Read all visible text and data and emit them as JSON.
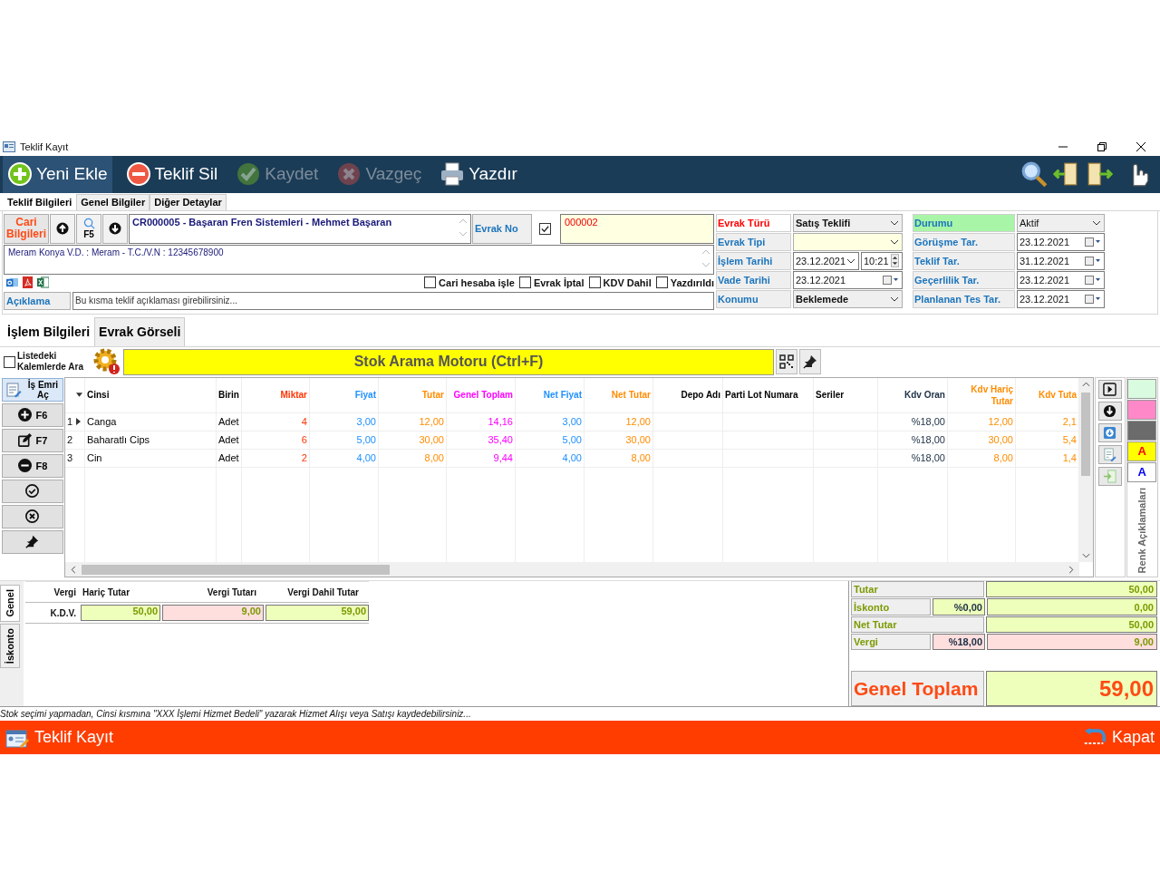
{
  "window": {
    "title": "Teklif Kayıt"
  },
  "toolbar": [
    {
      "label": "Yeni Ekle",
      "kind": "add",
      "disabled": false,
      "selected": true
    },
    {
      "label": "Teklif Sil",
      "kind": "delete",
      "disabled": false,
      "selected": false
    },
    {
      "label": "Kaydet",
      "kind": "save",
      "disabled": true,
      "selected": false
    },
    {
      "label": "Vazgeç",
      "kind": "cancel",
      "disabled": true,
      "selected": false
    },
    {
      "label": "Yazdır",
      "kind": "print",
      "disabled": false,
      "selected": false
    }
  ],
  "form_tabs": [
    {
      "label": "Teklif Bilgileri",
      "selected": true
    },
    {
      "label": "Genel Bilgiler",
      "selected": false
    },
    {
      "label": "Diğer Detaylar",
      "selected": false
    }
  ],
  "cari": {
    "button": "Cari Bilgileri",
    "search_key": "F5",
    "name": "CR000005 - Başaran Fren Sistemleri - Mehmet Başaran",
    "info": "Meram Konya V.D. :  Meram - T.C./V.N :  12345678900"
  },
  "evrak_no": {
    "label": "Evrak No",
    "checked": true,
    "value": "000002"
  },
  "options": [
    {
      "label": "Cari hesaba işle",
      "checked": false
    },
    {
      "label": "Evrak İptal",
      "checked": false
    },
    {
      "label": "KDV Dahil",
      "checked": false
    },
    {
      "label": "Yazdırıldı",
      "checked": false
    }
  ],
  "aciklama": {
    "label": "Açıklama",
    "placeholder": "Bu kısma teklif açıklaması girebilirsiniz..."
  },
  "doc_fields": [
    {
      "label": "Evrak Türü",
      "kind": "select",
      "value": "Satış Teklifi",
      "required": true
    },
    {
      "label": "Evrak Tipi",
      "kind": "select",
      "required": false
    },
    {
      "label": "İşlem Tarihi",
      "kind": "datetime",
      "value": "23.12.2021",
      "time": "10:21",
      "required": false
    },
    {
      "label": "Vade Tarihi",
      "kind": "date",
      "value": "23.12.2021",
      "required": false
    },
    {
      "label": "Konumu",
      "kind": "select",
      "value": "Beklemede",
      "required": false
    }
  ],
  "status_fields": [
    {
      "label": "Durumu",
      "kind": "select",
      "value": "Aktif",
      "highlighted": true
    },
    {
      "label": "Görüşme Tar.",
      "kind": "date",
      "value": "23.12.2021",
      "highlighted": false
    },
    {
      "label": "Teklif Tar.",
      "kind": "date",
      "value": "31.12.2021",
      "highlighted": false
    },
    {
      "label": "Geçerlilik Tar.",
      "kind": "date",
      "value": "23.12.2021",
      "highlighted": false
    },
    {
      "label": "Planlanan Tes Tar.",
      "kind": "date",
      "value": "23.12.2021",
      "highlighted": false
    }
  ],
  "detail_tabs": [
    {
      "label": "İşlem Bilgileri",
      "selected": true
    },
    {
      "label": "Evrak Görseli",
      "selected": false
    }
  ],
  "search": {
    "label": "Listedeki Kalemlerde Ara",
    "checked": false,
    "title": "Stok Arama Motoru (Ctrl+F)"
  },
  "side_buttons": [
    {
      "kind": "work-order",
      "label": "İş Emri Aç"
    },
    {
      "kind": "add",
      "label": "F6"
    },
    {
      "kind": "edit",
      "label": "F7"
    },
    {
      "kind": "remove",
      "label": "F8"
    },
    {
      "kind": "approve"
    },
    {
      "kind": "cancel"
    },
    {
      "kind": "pin"
    }
  ],
  "table": {
    "columns": [
      {
        "label": "Cinsi",
        "color": "#000000"
      },
      {
        "label": "Birin",
        "color": "#000000"
      },
      {
        "label": "Miktar",
        "color": "#ff3300"
      },
      {
        "label": "Fiyat",
        "color": "#1e90ff"
      },
      {
        "label": "Tutar",
        "color": "#ff8c00"
      },
      {
        "label": "Genel Toplam",
        "color": "#ff00ff"
      },
      {
        "label": "Net Fiyat",
        "color": "#1e90ff"
      },
      {
        "label": "Net Tutar",
        "color": "#ff8c00"
      },
      {
        "label": "Depo Adı",
        "color": "#000000"
      },
      {
        "label": "Parti Lot Numara",
        "color": "#000000"
      },
      {
        "label": "Seriler",
        "color": "#000000"
      },
      {
        "label": "Kdv Oran",
        "color": "#1c2f45"
      },
      {
        "label": "Kdv Hariç Tutar",
        "color": "#ff8c00"
      },
      {
        "label": "Kdv Tuta",
        "color": "#ff8c00"
      }
    ],
    "rows": [
      {
        "number": "1",
        "current": true,
        "cells": [
          "Canga",
          "Adet",
          "4",
          "3,00",
          "12,00",
          "14,16",
          "3,00",
          "12,00",
          null,
          null,
          null,
          "%18,00",
          "12,00",
          "2,1"
        ]
      },
      {
        "number": "2",
        "current": false,
        "cells": [
          "Baharatlı Cips",
          "Adet",
          "6",
          "5,00",
          "30,00",
          "35,40",
          "5,00",
          "30,00",
          null,
          null,
          null,
          "%18,00",
          "30,00",
          "5,4"
        ]
      },
      {
        "number": "3",
        "current": false,
        "cells": [
          "Cin",
          "Adet",
          "2",
          "4,00",
          "8,00",
          "9,44",
          "4,00",
          "8,00",
          null,
          null,
          null,
          "%18,00",
          "8,00",
          "1,4"
        ]
      }
    ]
  },
  "legend": {
    "title": "Renk Açıklamaları",
    "items": [
      {
        "color": "#d9fbdf"
      },
      {
        "color": "#ff88c8"
      },
      {
        "color": "#6b6b6b"
      },
      {
        "color": "#ffff00",
        "letter": {
          "text": "A",
          "color": "#ff0000"
        }
      },
      {
        "color": "#ffffff",
        "letter": {
          "text": "A",
          "color": "#0000ff"
        }
      }
    ]
  },
  "tax_tabs": [
    {
      "label": "Genel",
      "selected": true
    },
    {
      "label": "İskonto",
      "selected": false
    }
  ],
  "tax_table": {
    "columns": [
      "Vergi",
      "Hariç Tutar",
      "Vergi Tutarı",
      "Vergi Dahil Tutar"
    ],
    "rows": [
      {
        "cells": [
          "K.D.V.",
          "50,00",
          "9,00",
          "59,00"
        ]
      }
    ]
  },
  "totals": [
    {
      "label": "Tutar",
      "value": "50,00",
      "kind": "amount"
    },
    {
      "label": "İskonto",
      "rate": "%0,00",
      "value": "0,00",
      "kind": "amount"
    },
    {
      "label": "Net Tutar",
      "value": "50,00",
      "kind": "amount"
    },
    {
      "label": "Vergi",
      "rate": "%18,00",
      "value": "9,00",
      "kind": "tax"
    }
  ],
  "grand_total": {
    "label": "Genel Toplam",
    "value": "59,00"
  },
  "hint": "Stok seçimi yapmadan, Cinsi kısmına \"XXX İşlemi Hizmet Bedeli\" yazarak Hizmet Alışı veya Satışı kaydedebilirsiniz...",
  "footer": {
    "title": "Teklif Kayıt",
    "close": "Kapat"
  }
}
